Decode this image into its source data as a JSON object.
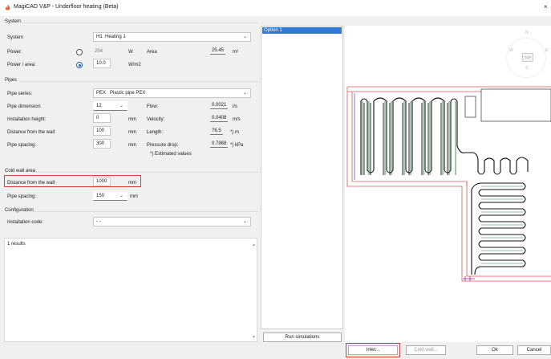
{
  "window": {
    "title": "MagiCAD V&P - Underfloor heating (Beta)",
    "close_glyph": "×"
  },
  "system": {
    "group_title": "System",
    "system_label": "System",
    "system_value_code": "H1",
    "system_value_name": "Heating 1",
    "power_label": "Power:",
    "power_value": "254",
    "power_unit": "W",
    "area_label": "Area",
    "area_value": "25.45",
    "area_unit": "m²",
    "power_area_label": "Power / area:",
    "power_area_value": "10.0",
    "power_area_unit": "W/m2",
    "selected_radio": "power_area"
  },
  "pipes": {
    "group_title": "Pipes",
    "series_label": "Pipe series:",
    "series_code": "PEX",
    "series_name": "Plastic pipe PEX",
    "dimension_label": "Pipe dimension:",
    "dimension_value": "12",
    "install_height_label": "Installation height:",
    "install_height_value": "0",
    "install_height_unit": "mm",
    "distance_wall_label": "Distance from the wall:",
    "distance_wall_value": "100",
    "distance_wall_unit": "mm",
    "spacing_label": "Pipe spacing:",
    "spacing_value": "300",
    "spacing_unit": "mm",
    "flow_label": "Flow:",
    "flow_value": "0.0021",
    "flow_unit": "l/s",
    "velocity_label": "Velocity:",
    "velocity_value": "0.0408",
    "velocity_unit": "m/s",
    "length_label": "Length:",
    "length_value": "76.5",
    "length_unit": "*) m",
    "pressure_label": "Pressure drop:",
    "pressure_value": "0.7868",
    "pressure_unit": "*) kPa",
    "footnote": "*) Estimated values"
  },
  "cold_wall": {
    "group_title": "Cold wall area",
    "distance_label": "Distance from the wall:",
    "distance_value": "1000",
    "distance_unit": "mm",
    "spacing_label": "Pipe spacing:",
    "spacing_value": "150",
    "spacing_unit": "mm"
  },
  "configuration": {
    "group_title": "Configuration",
    "install_code_label": "Installation code:",
    "install_code_value": "- -"
  },
  "results": {
    "text": "1 results"
  },
  "options": {
    "items": [
      "Option 1"
    ]
  },
  "buttons": {
    "run_simulations": "Run simulations",
    "inlet": "Inlet...",
    "cold_wall": "Cold wall...",
    "ok": "Ok",
    "cancel": "Cancel"
  },
  "compass": {
    "north": "N",
    "south": "S",
    "east": "E",
    "west": "W",
    "center": "TOP"
  },
  "icons": {
    "app": "magicad-flame-icon",
    "dropdown": "chevron-down-icon",
    "scroll_up": "scroll-up-arrow-icon",
    "scroll_down": "scroll-down-arrow-icon"
  },
  "colors": {
    "highlight_red": "#e53935",
    "selection_blue": "#2f78d6",
    "pipe_green": "#1f7a3d",
    "wall_red": "#e05252",
    "outline_blue": "#3a3ae0",
    "pipe_black": "#111111"
  }
}
